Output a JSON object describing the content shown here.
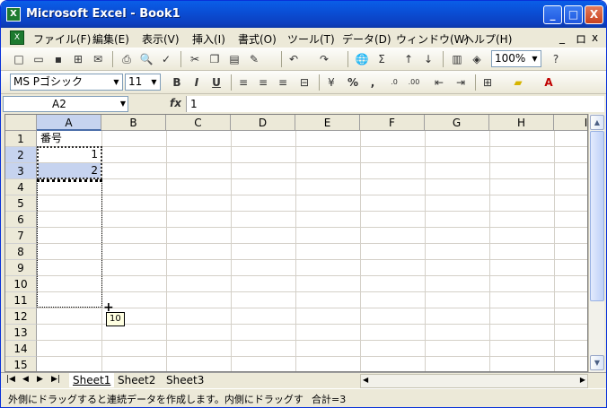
{
  "app": {
    "title": "Microsoft Excel - Book1",
    "window_controls": [
      "_",
      "□",
      "X"
    ]
  },
  "menu": {
    "items": [
      "ファイル(F)",
      "編集(E)",
      "表示(V)",
      "挿入(I)",
      "書式(O)",
      "ツール(T)",
      "データ(D)",
      "ウィンドウ(W)",
      "ヘルプ(H)"
    ],
    "doc_controls": [
      "_",
      "ロ",
      "x"
    ]
  },
  "toolbar": {
    "zoom": "100%",
    "font_name": "MS Pゴシック",
    "font_size": "11"
  },
  "formula_bar": {
    "name_box": "A2",
    "fx": "fx",
    "value": "1"
  },
  "grid": {
    "columns": [
      "A",
      "B",
      "C",
      "D",
      "E",
      "F",
      "G",
      "H",
      "I"
    ],
    "rows": [
      "1",
      "2",
      "3",
      "4",
      "5",
      "6",
      "7",
      "8",
      "9",
      "10",
      "11",
      "12",
      "13",
      "14",
      "15"
    ],
    "cells": {
      "A1": "番号",
      "A2": "1",
      "A3": "2"
    },
    "fill_tooltip": "10"
  },
  "sheets": {
    "tabs": [
      "Sheet1",
      "Sheet2",
      "Sheet3"
    ],
    "active": "Sheet1"
  },
  "status": {
    "message": "外側にドラッグすると連続データを作成します。内側にドラッグす",
    "sum": "合計=3"
  },
  "colors": {
    "title_bar": "#0a4fd6",
    "selection": "#c6d3ef",
    "chrome": "#ece9d8"
  }
}
